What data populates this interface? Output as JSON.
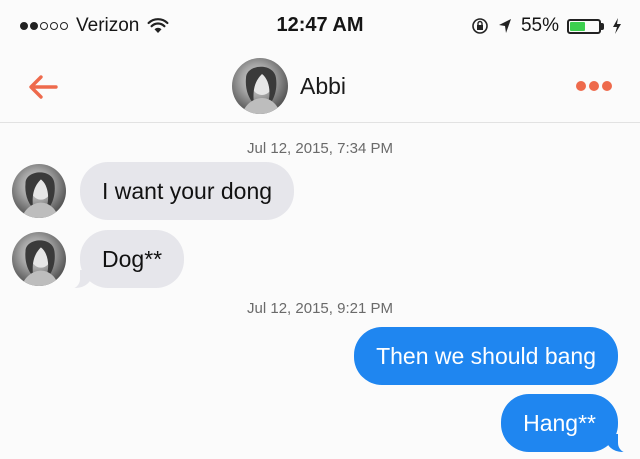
{
  "status_bar": {
    "carrier": "Verizon",
    "time": "12:47 AM",
    "battery_percent": "55%",
    "battery_level": 0.55,
    "signal_bars": 2,
    "icons": [
      "wifi-icon",
      "lock-rotation-icon",
      "location-arrow-icon",
      "battery-icon",
      "charging-bolt-icon"
    ]
  },
  "nav": {
    "contact_name": "Abbi",
    "back_icon": "arrow-left-icon",
    "more_icon": "more-dots-icon",
    "accent_color": "#ee6a4c"
  },
  "conversation": {
    "groups": [
      {
        "timestamp": "Jul 12, 2015, 7:34 PM",
        "messages": [
          {
            "direction": "incoming",
            "text": "I want your dong"
          },
          {
            "direction": "incoming",
            "text": "Dog**"
          }
        ]
      },
      {
        "timestamp": "Jul 12, 2015, 9:21 PM",
        "messages": [
          {
            "direction": "outgoing",
            "text": "Then we should bang"
          },
          {
            "direction": "outgoing",
            "text": "Hang**"
          }
        ]
      }
    ],
    "colors": {
      "incoming_bubble": "#e6e6eb",
      "outgoing_bubble": "#1f86f0"
    }
  }
}
